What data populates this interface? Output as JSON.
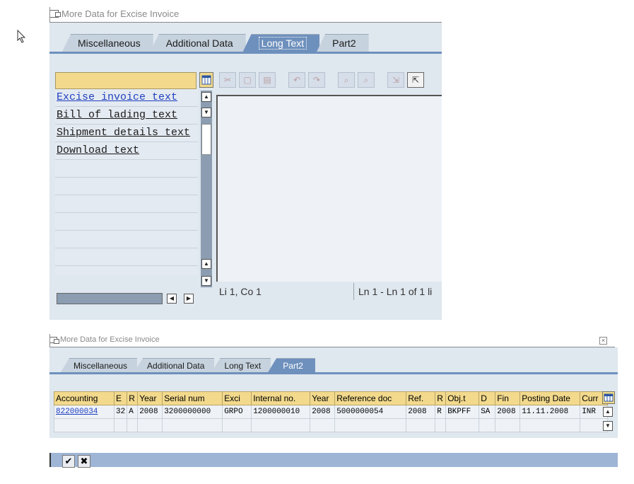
{
  "dialog1": {
    "title": "More Data for Excise Invoice",
    "tabs": [
      {
        "label": "Miscellaneous",
        "active": false
      },
      {
        "label": "Additional Data",
        "active": false
      },
      {
        "label": "Long Text",
        "active": true
      },
      {
        "label": "Part2",
        "active": false
      }
    ],
    "text_list": [
      "Excise invoice text",
      "Bill of lading text",
      "Shipment details text",
      "Download text"
    ],
    "status_left": "Li 1, Co 1",
    "status_right": "Ln 1 - Ln 1 of 1 li"
  },
  "dialog2": {
    "title": "More Data for Excise Invoice",
    "tabs": [
      {
        "label": "Miscellaneous",
        "active": false
      },
      {
        "label": "Additional Data",
        "active": false
      },
      {
        "label": "Long Text",
        "active": false
      },
      {
        "label": "Part2",
        "active": true
      }
    ],
    "table": {
      "headers": [
        "Accounting",
        "E",
        "R",
        "Year",
        "Serial num",
        "Exci",
        "Internal no.",
        "Year",
        "Reference doc",
        "Ref.",
        "R",
        "Obj.t",
        "D",
        "Fin",
        "Posting Date",
        "Curr"
      ],
      "row": [
        "822000034",
        "32",
        "A",
        "2008",
        "3200000000",
        "GRPO",
        "1200000010",
        "2008",
        "5000000054",
        "2008",
        "R",
        "BKPFF",
        "SA",
        "2008",
        "11.11.2008",
        "INR"
      ]
    }
  },
  "icons": [
    "cursor-icon",
    "groupbox-icon",
    "column-config-icon",
    "cut-icon",
    "copy-icon",
    "paste-icon",
    "undo-icon",
    "redo-icon",
    "find-icon",
    "find-next-icon",
    "import-icon",
    "export-icon",
    "confirm-icon",
    "cancel-icon"
  ]
}
